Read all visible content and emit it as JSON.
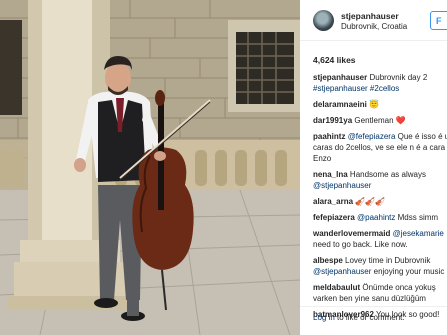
{
  "post": {
    "username": "stjepanhauser",
    "location": "Dubrovnik, Croatia",
    "follow_label": "F",
    "likes": "4,624 likes",
    "caption": {
      "user": "stjepanhauser",
      "text": "Dubrovnik day 2",
      "tags": "#stjepanhauser #2cellos"
    }
  },
  "comments": [
    {
      "user": "delaramnaeini",
      "text": "😇",
      "tag": ""
    },
    {
      "user": "dar1991ya",
      "text": "Gentleman ❤️",
      "tag": ""
    },
    {
      "user": "paahintz",
      "text": "Que é isso é um do",
      "tag": "@fefepiazera"
    },
    {
      "user": "",
      "text": "caras do 2cellos, ve se ele n é a cara",
      "tag": ""
    },
    {
      "user": "",
      "text": "Enzo",
      "tag": ""
    },
    {
      "user": "nena_lna",
      "text": "Handsome as always",
      "tag": ""
    },
    {
      "user": "",
      "text": "",
      "tag": "@stjepanhauser"
    },
    {
      "user": "alara_arna",
      "text": "🎻🎻🎻",
      "tag": ""
    },
    {
      "user": "fefepiazera",
      "text": "Mdss simm",
      "tag": "@paahintz"
    },
    {
      "user": "wanderlovemermaid",
      "text": "",
      "tag": "@jesekamarie"
    },
    {
      "user": "",
      "text": "need to go back. Like now.",
      "tag": ""
    },
    {
      "user": "albespe",
      "text": "Lovey time in Dubrovnik",
      "tag": ""
    },
    {
      "user": "",
      "text": "enjoying your music",
      "tag": "@stjepanhauser"
    },
    {
      "user": "meldabaulut",
      "text": "Önümde onca yokuş",
      "tag": ""
    },
    {
      "user": "",
      "text": "varken ben yine sanu düzlüğüm",
      "tag": ""
    },
    {
      "user": "batmanlover962",
      "text": "You look so good!",
      "tag": ""
    }
  ],
  "footer": {
    "login_link": "Log in",
    "login_rest": " to like or comment."
  }
}
